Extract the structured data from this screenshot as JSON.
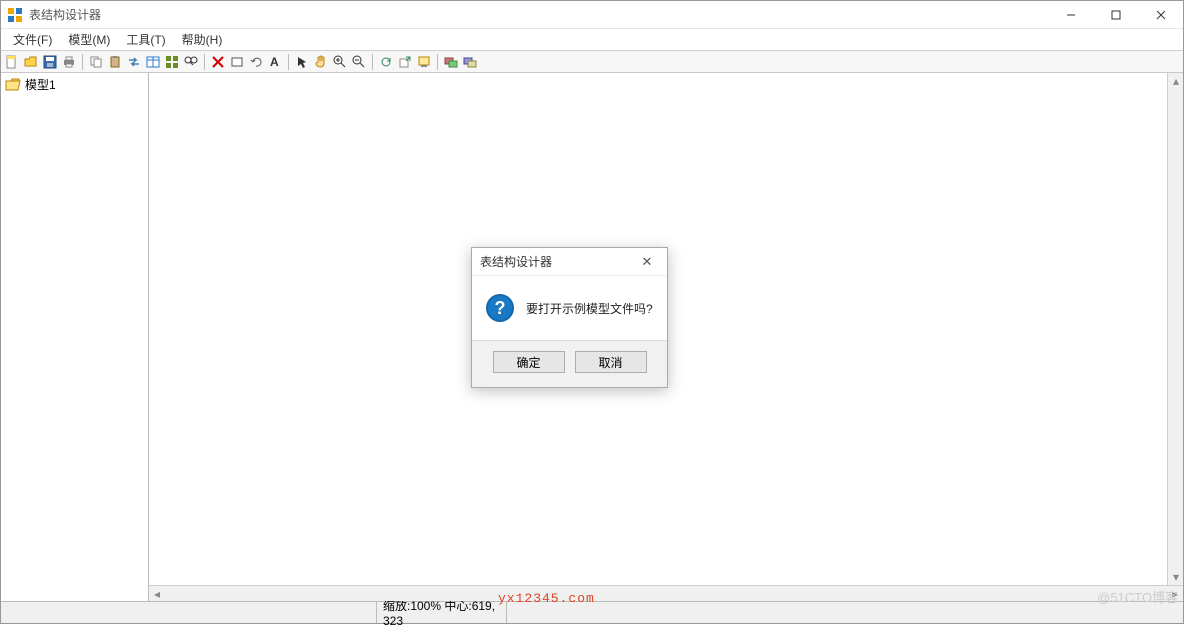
{
  "titlebar": {
    "title": "表结构设计器"
  },
  "menubar": {
    "file": "文件(F)",
    "model": "模型(M)",
    "tool": "工具(T)",
    "help": "帮助(H)"
  },
  "toolbar_icons": [
    "new",
    "open",
    "save",
    "print",
    "copy",
    "paste",
    "swap",
    "table",
    "grid",
    "find",
    "delete",
    "rect",
    "undo",
    "text",
    "pointer",
    "hand",
    "zoom-in",
    "zoom-out",
    "refresh",
    "export",
    "import",
    "layer1",
    "layer2"
  ],
  "sidebar": {
    "items": [
      {
        "label": "模型1"
      }
    ]
  },
  "statusbar": {
    "zoom": "缩放:100% 中心:619, 323"
  },
  "dialog": {
    "title": "表结构设计器",
    "message": "要打开示例模型文件吗?",
    "ok": "确定",
    "cancel": "取消"
  },
  "watermarks": {
    "w1": "yx12345.com",
    "w2": "@51CTO博客"
  }
}
